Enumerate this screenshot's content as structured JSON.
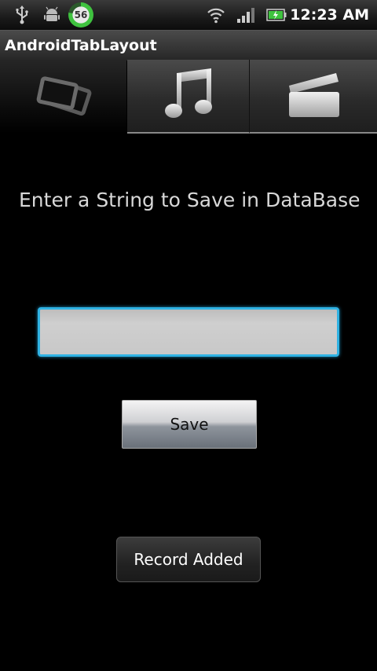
{
  "status_bar": {
    "icons": [
      "usb-icon",
      "android-debug-icon",
      "battery-badge-icon",
      "wifi-icon",
      "signal-icon",
      "battery-icon"
    ],
    "badge_value": "56",
    "time": "12:23 AM"
  },
  "app": {
    "title": "AndroidTabLayout"
  },
  "tabs": [
    {
      "icon": "photos-icon",
      "selected": true
    },
    {
      "icon": "music-note-icon",
      "selected": false
    },
    {
      "icon": "video-clapper-icon",
      "selected": false
    }
  ],
  "main": {
    "prompt": "Enter a String to Save in DataBase",
    "input_value": "",
    "save_label": "Save",
    "toast": "Record Added"
  },
  "colors": {
    "focus_border": "#2fb2e3",
    "battery_badge_green": "#3fc23f"
  }
}
